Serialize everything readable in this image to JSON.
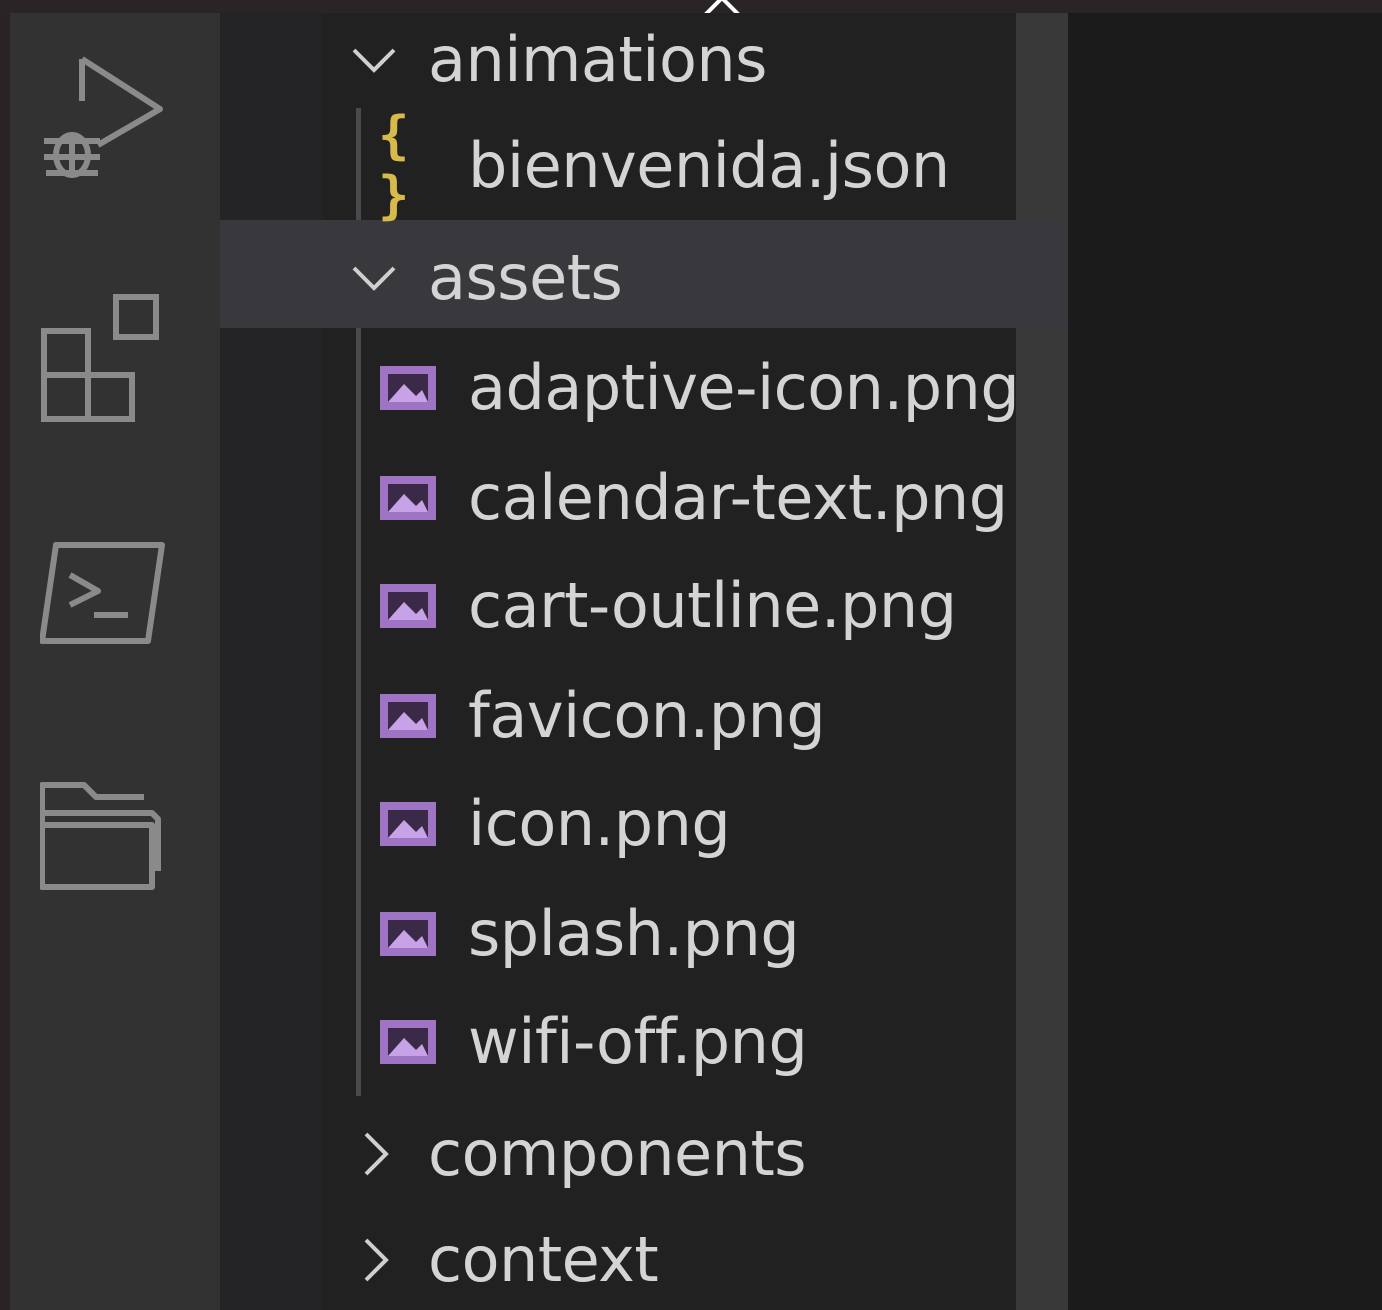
{
  "colors": {
    "image_icon": "#a074c4",
    "json_icon": "#d7ba4c",
    "label": "#d4d4d4",
    "icon_stroke": "#8a8a8a"
  },
  "activity_bar": {
    "items": [
      {
        "name": "run-debug",
        "icon": "run-debug-icon"
      },
      {
        "name": "extensions",
        "icon": "extensions-icon"
      },
      {
        "name": "terminal",
        "icon": "terminal-icon"
      },
      {
        "name": "explorer",
        "icon": "folder-icon"
      }
    ]
  },
  "tree": {
    "folders": {
      "animations": {
        "label": "animations",
        "expanded": true
      },
      "assets": {
        "label": "assets",
        "expanded": true
      },
      "components": {
        "label": "components",
        "expanded": false
      },
      "context": {
        "label": "context",
        "expanded": false
      }
    },
    "files": {
      "bienvenida": {
        "label": "bienvenida.json",
        "icon": "{ }"
      },
      "adaptive_icon": {
        "label": "adaptive-icon.png"
      },
      "calendar_text": {
        "label": "calendar-text.png"
      },
      "cart_outline": {
        "label": "cart-outline.png"
      },
      "favicon": {
        "label": "favicon.png"
      },
      "icon": {
        "label": "icon.png"
      },
      "splash": {
        "label": "splash.png"
      },
      "wifi_off": {
        "label": "wifi-off.png"
      }
    }
  }
}
